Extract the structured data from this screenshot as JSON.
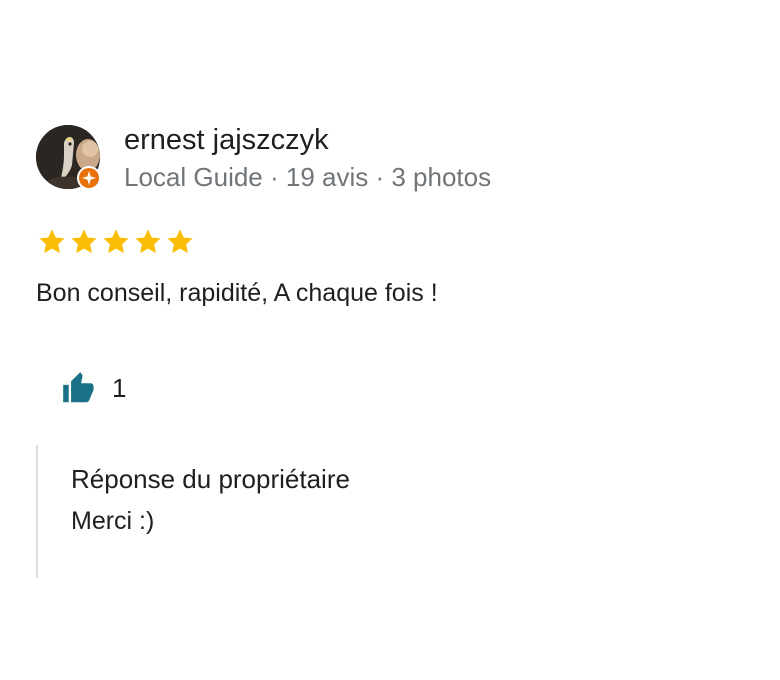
{
  "review": {
    "author": {
      "name": "ernest jajszczyk",
      "meta": "Local Guide · 19 avis · 3 photos",
      "avatar_icon": "user-photo-avatar",
      "badge_icon": "local-guide-badge-icon",
      "badge_color": "#e8710a"
    },
    "rating": {
      "stars": 5,
      "max": 5,
      "star_color": "#fbbc04"
    },
    "text": "Bon conseil, rapidité, A chaque fois !",
    "likes": {
      "icon": "thumbs-up-icon",
      "count": "1",
      "icon_color": "#1a7087"
    },
    "owner_response": {
      "title": "Réponse du propriétaire",
      "text": "Merci :)"
    }
  }
}
